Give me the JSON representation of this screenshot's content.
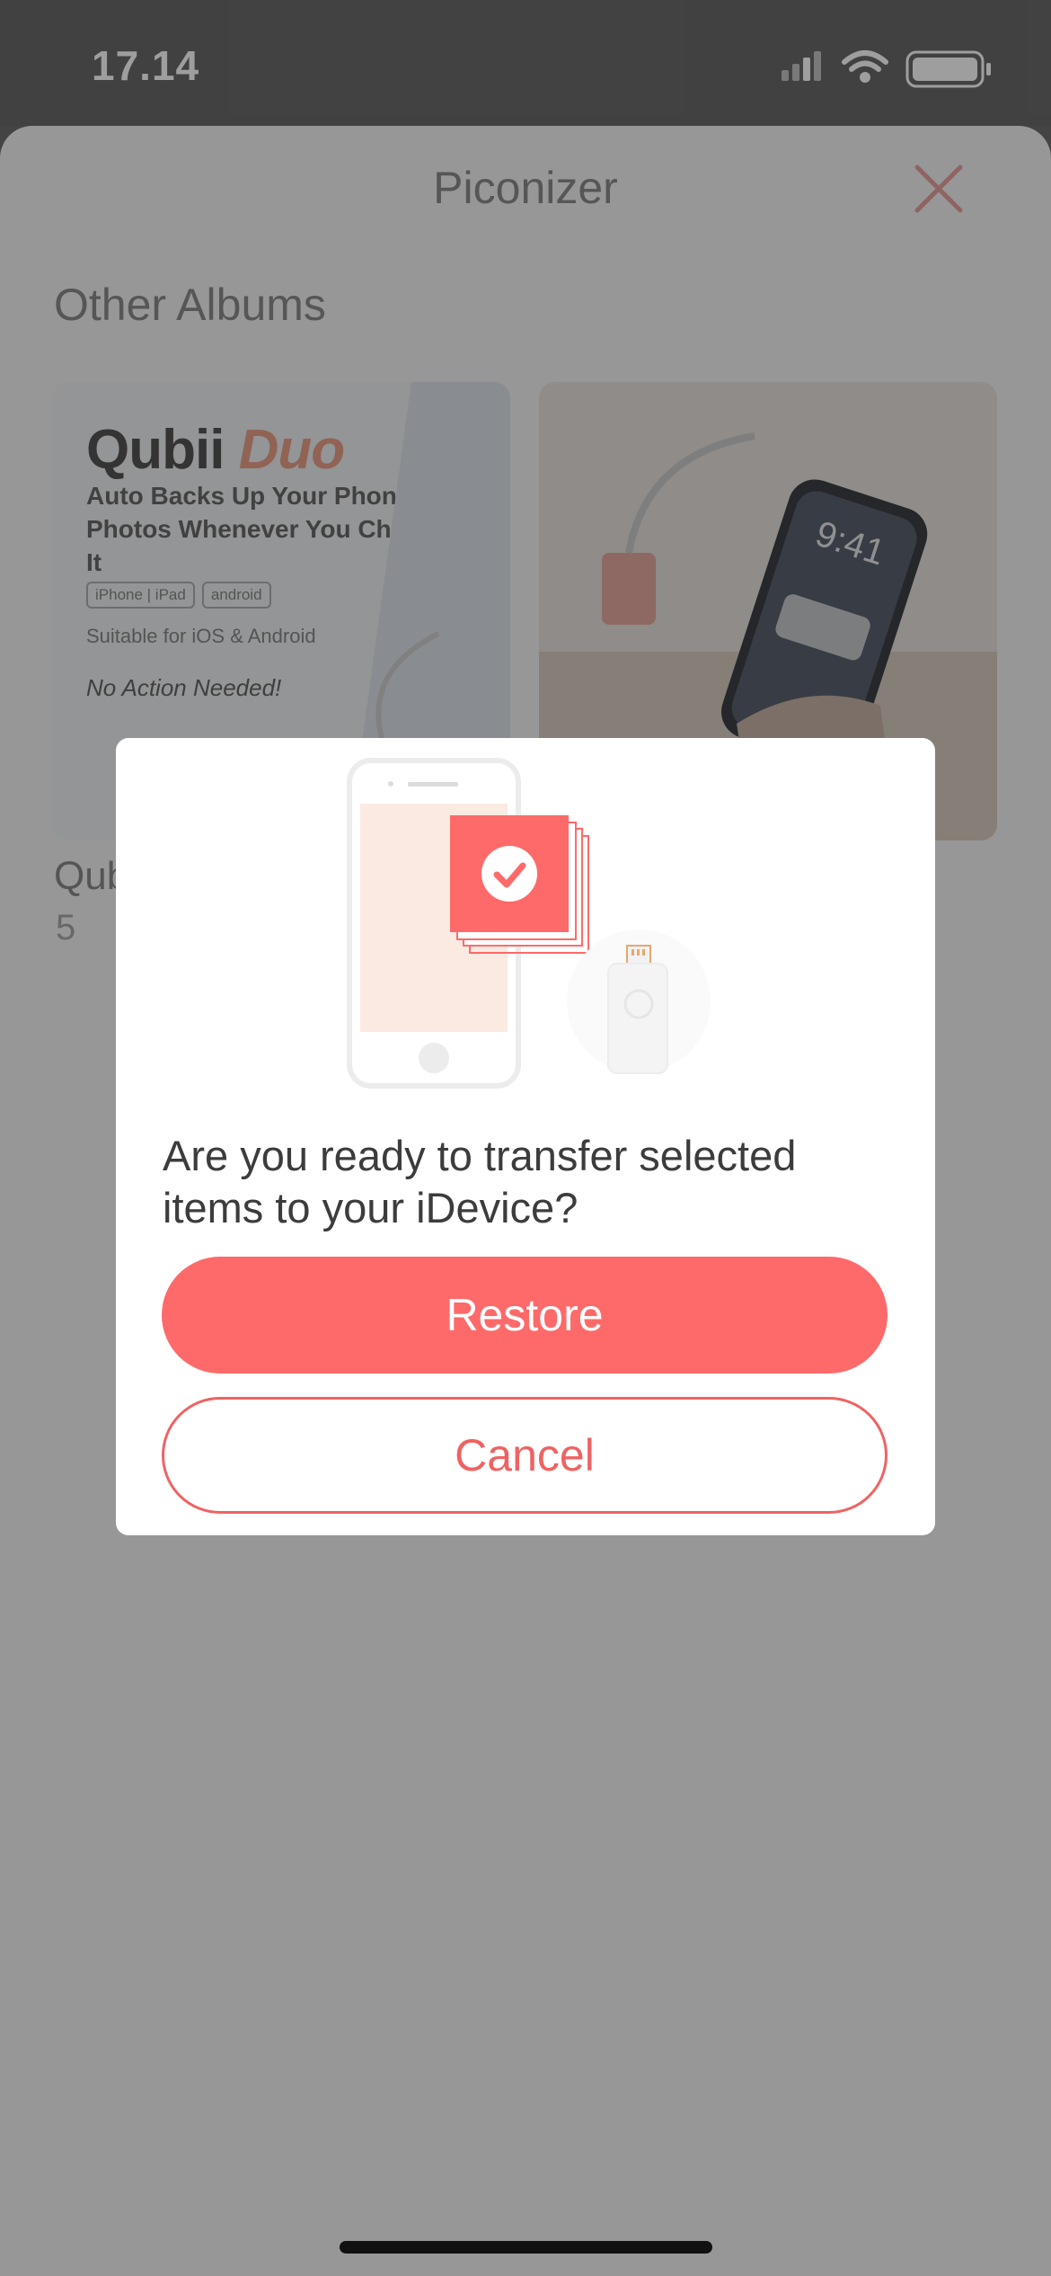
{
  "status_bar": {
    "time": "17.14",
    "icons": [
      "cellular-signal-icon",
      "wifi-icon",
      "battery-icon"
    ]
  },
  "header": {
    "title": "Piconizer",
    "close_icon": "close-icon"
  },
  "section": {
    "title": "Other Albums"
  },
  "albums": [
    {
      "name": "Qub",
      "count": "5",
      "promo": {
        "brand": "Qubii",
        "brand_suffix": "Duo",
        "tagline": "Auto Backs Up Your Phone's Photos Whenever You Charge It",
        "badges": [
          "iPhone | iPad",
          "android"
        ],
        "suitable": "Suitable for iOS & Android",
        "no_action": "No Action Needed!"
      }
    },
    {
      "name": "",
      "count": "",
      "phone_time": "9:41"
    }
  ],
  "dialog": {
    "message": "Are you ready to transfer selected items to your iDevice?",
    "primary_button": "Restore",
    "secondary_button": "Cancel",
    "illustration_icons": [
      "phone-icon",
      "photo-stack-check-icon",
      "lightning-drive-icon"
    ]
  },
  "colors": {
    "accent": "#fe6a6a",
    "accent_text": "#f06262"
  }
}
